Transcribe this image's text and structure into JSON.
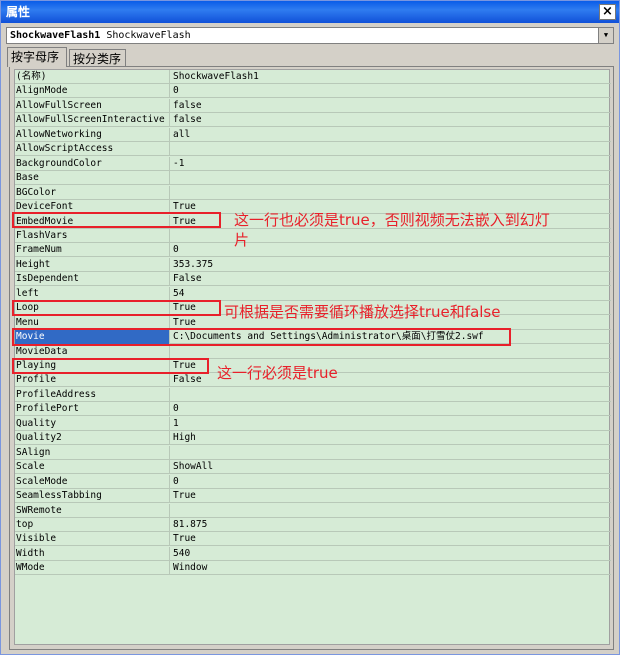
{
  "window": {
    "title": "属性",
    "close_glyph": "×"
  },
  "object_selector": {
    "name": "ShockwaveFlash1",
    "type": "ShockwaveFlash",
    "arrow": "▼"
  },
  "tabs": [
    {
      "label": "按字母序",
      "active": true
    },
    {
      "label": "按分类序",
      "active": false
    }
  ],
  "properties": [
    {
      "name": "(名称)",
      "value": "ShockwaveFlash1"
    },
    {
      "name": "AlignMode",
      "value": "0"
    },
    {
      "name": "AllowFullScreen",
      "value": "false"
    },
    {
      "name": "AllowFullScreenInteractive",
      "value": "false"
    },
    {
      "name": "AllowNetworking",
      "value": "all"
    },
    {
      "name": "AllowScriptAccess",
      "value": ""
    },
    {
      "name": "BackgroundColor",
      "value": "-1"
    },
    {
      "name": "Base",
      "value": ""
    },
    {
      "name": "BGColor",
      "value": ""
    },
    {
      "name": "DeviceFont",
      "value": "True"
    },
    {
      "name": "EmbedMovie",
      "value": "True"
    },
    {
      "name": "FlashVars",
      "value": ""
    },
    {
      "name": "FrameNum",
      "value": "0"
    },
    {
      "name": "Height",
      "value": "353.375"
    },
    {
      "name": "IsDependent",
      "value": "False"
    },
    {
      "name": "left",
      "value": "54"
    },
    {
      "name": "Loop",
      "value": "True"
    },
    {
      "name": "Menu",
      "value": "True"
    },
    {
      "name": "Movie",
      "value": "C:\\Documents and Settings\\Administrator\\桌面\\打雪仗2.swf"
    },
    {
      "name": "MovieData",
      "value": ""
    },
    {
      "name": "Playing",
      "value": "True"
    },
    {
      "name": "Profile",
      "value": "False"
    },
    {
      "name": "ProfileAddress",
      "value": ""
    },
    {
      "name": "ProfilePort",
      "value": "0"
    },
    {
      "name": "Quality",
      "value": "1"
    },
    {
      "name": "Quality2",
      "value": "High"
    },
    {
      "name": "SAlign",
      "value": ""
    },
    {
      "name": "Scale",
      "value": "ShowAll"
    },
    {
      "name": "ScaleMode",
      "value": "0"
    },
    {
      "name": "SeamlessTabbing",
      "value": "True"
    },
    {
      "name": "SWRemote",
      "value": ""
    },
    {
      "name": "top",
      "value": "81.875"
    },
    {
      "name": "Visible",
      "value": "True"
    },
    {
      "name": "Width",
      "value": "540"
    },
    {
      "name": "WMode",
      "value": "Window"
    }
  ],
  "selected_property": "Movie",
  "annotations": {
    "embed_note_line1": "这一行也必须是true，否则视频无法嵌入到幻灯",
    "embed_note_line2": "片",
    "loop_note": "可根据是否需要循环播放选择true和false",
    "playing_note": "这一行必须是true"
  },
  "colors": {
    "grid_bg": "#d6ebd6",
    "selection": "#316ac5",
    "annotation_red": "#e8202a",
    "titlebar": "#0a5ce8"
  }
}
